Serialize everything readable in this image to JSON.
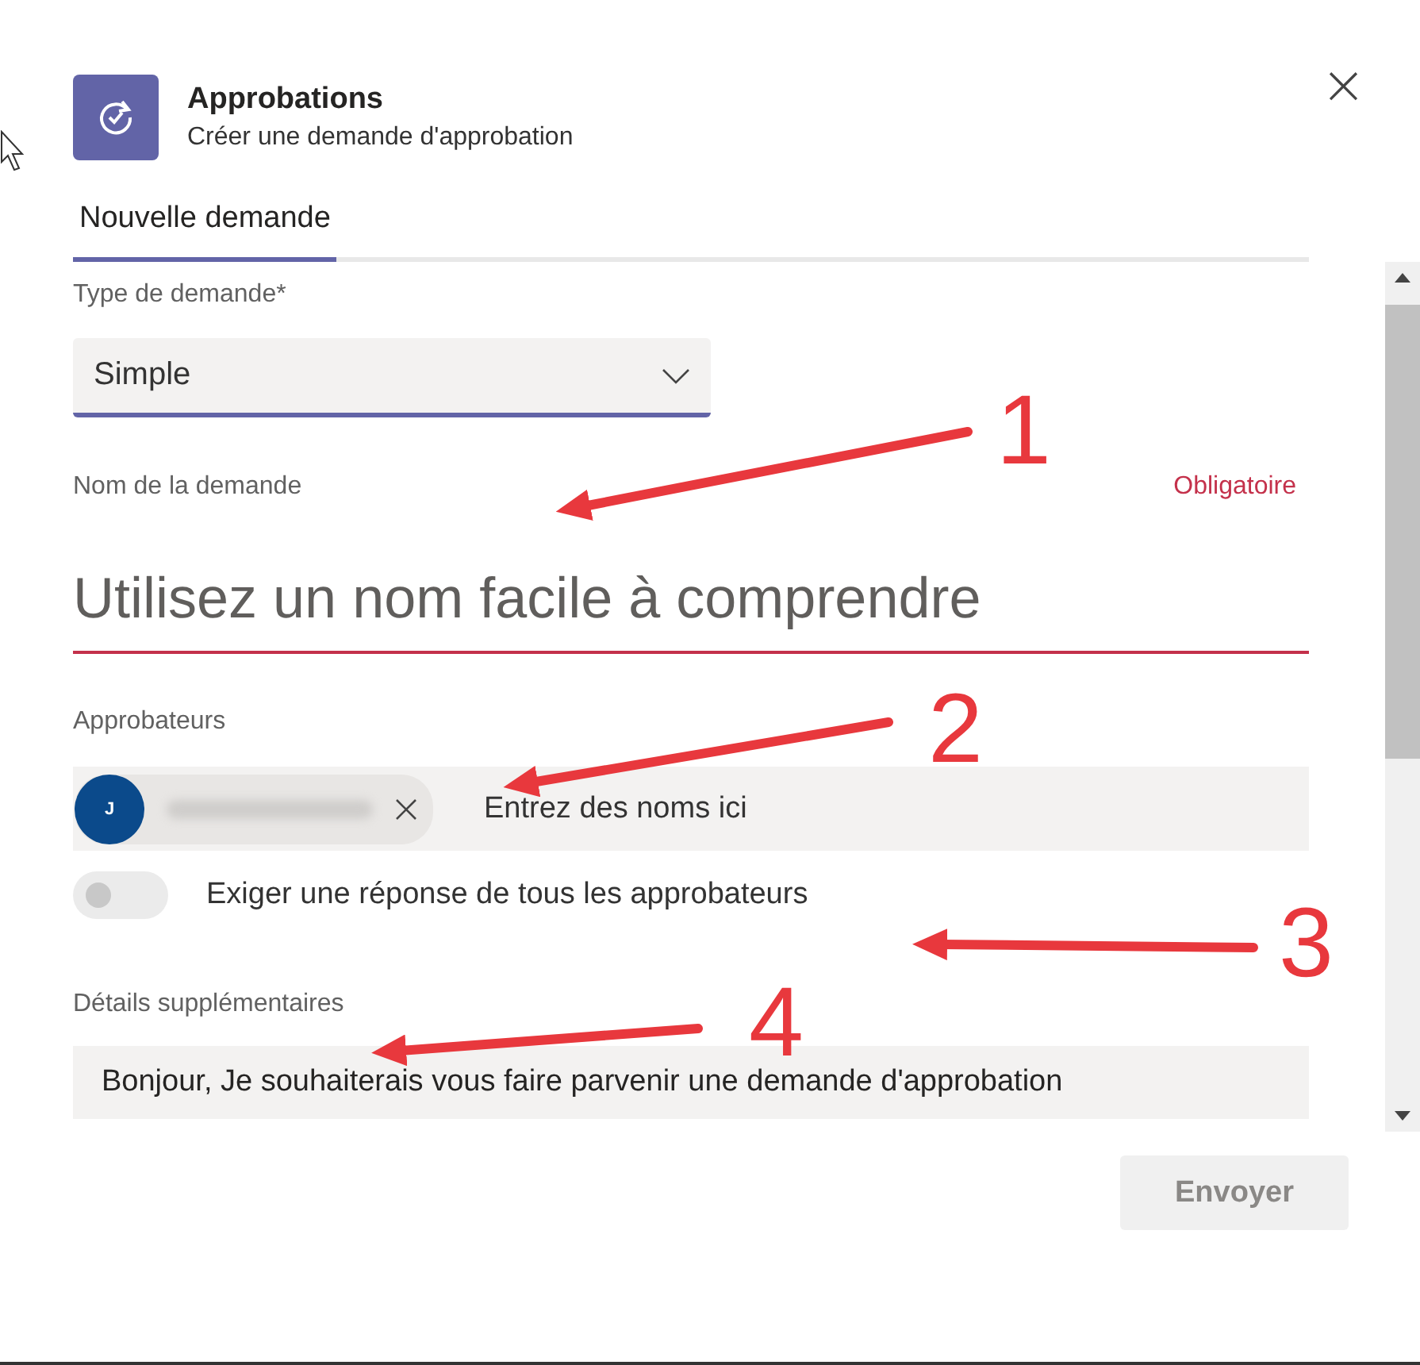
{
  "app": {
    "title": "Approbations",
    "subtitle": "Créer une demande d'approbation"
  },
  "close": "×",
  "tabs": [
    {
      "label": "Nouvelle demande",
      "selected": true
    }
  ],
  "form": {
    "type_label": "Type de demande*",
    "type_value": "Simple",
    "name_label": "Nom de la demande",
    "name_required": "Obligatoire",
    "name_placeholder": "Utilisez un nom facile à comprendre",
    "approvers_label": "Approbateurs",
    "approvers": [
      {
        "initial": "J"
      }
    ],
    "approvers_placeholder": "Entrez des noms ici",
    "toggle": {
      "label": "Exiger une réponse de tous les approbateurs",
      "on": false
    },
    "details_label": "Détails supplémentaires",
    "details_value": "Bonjour, Je souhaiterais vous faire parvenir une demande d'approbation"
  },
  "buttons": [
    {
      "label": "Envoyer",
      "disabled": true
    }
  ],
  "annotations": [
    {
      "label": "1"
    },
    {
      "label": "2"
    },
    {
      "label": "3"
    },
    {
      "label": "4"
    }
  ]
}
